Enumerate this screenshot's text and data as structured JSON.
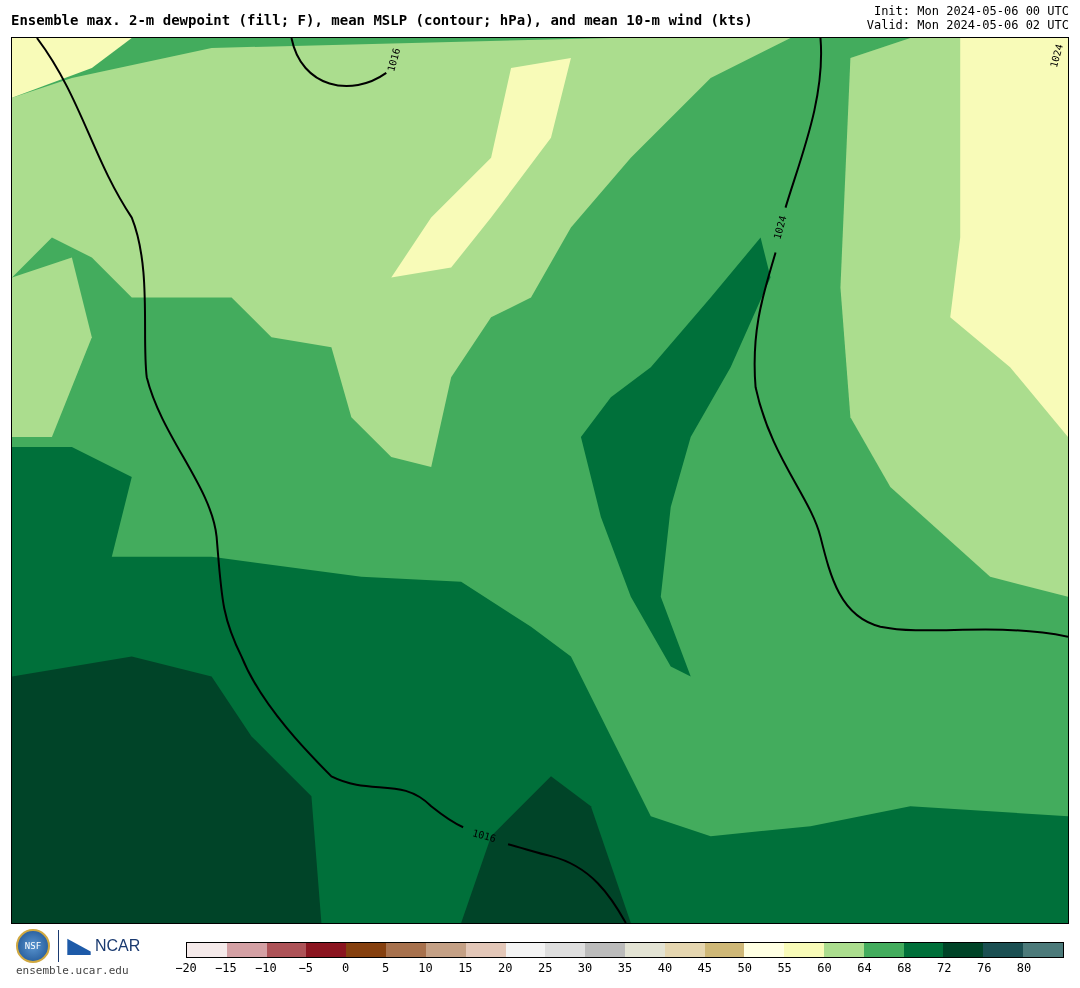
{
  "header": {
    "title": "Ensemble max. 2-m dewpoint (fill; F), mean MSLP (contour; hPa), and mean 10-m wind (kts)",
    "init": "Init: Mon 2024-05-06 00 UTC",
    "valid": "Valid: Mon 2024-05-06 02 UTC"
  },
  "map": {
    "contour_labels": [
      "1016",
      "1024",
      "1024",
      "1016"
    ]
  },
  "footer": {
    "nsf": "NSF",
    "ncar": "NCAR",
    "url": "ensemble.ucar.edu"
  },
  "colorbar": {
    "segments": [
      {
        "color": "#f5eaea"
      },
      {
        "color": "#d4a0a4"
      },
      {
        "color": "#ad5257"
      },
      {
        "color": "#8b1520"
      },
      {
        "color": "#85400f"
      },
      {
        "color": "#a7714d"
      },
      {
        "color": "#c4a085"
      },
      {
        "color": "#e3c7b8"
      },
      {
        "color": "#f3f3f3"
      },
      {
        "color": "#dedede"
      },
      {
        "color": "#bbbbbb"
      },
      {
        "color": "#e3e3d4"
      },
      {
        "color": "#e5d6b0"
      },
      {
        "color": "#cfb877"
      },
      {
        "color": "#ffffe2"
      },
      {
        "color": "#f8fbb8"
      },
      {
        "color": "#abdd8e"
      },
      {
        "color": "#43ac5d"
      },
      {
        "color": "#00703a"
      },
      {
        "color": "#004428"
      },
      {
        "color": "#1b4f52"
      },
      {
        "color": "#4c7a7a"
      }
    ],
    "ticks": [
      "−20",
      "−15",
      "−10",
      "−5",
      "0",
      "5",
      "10",
      "15",
      "20",
      "25",
      "30",
      "35",
      "40",
      "45",
      "50",
      "55",
      "60",
      "64",
      "68",
      "72",
      "76",
      "80"
    ]
  }
}
